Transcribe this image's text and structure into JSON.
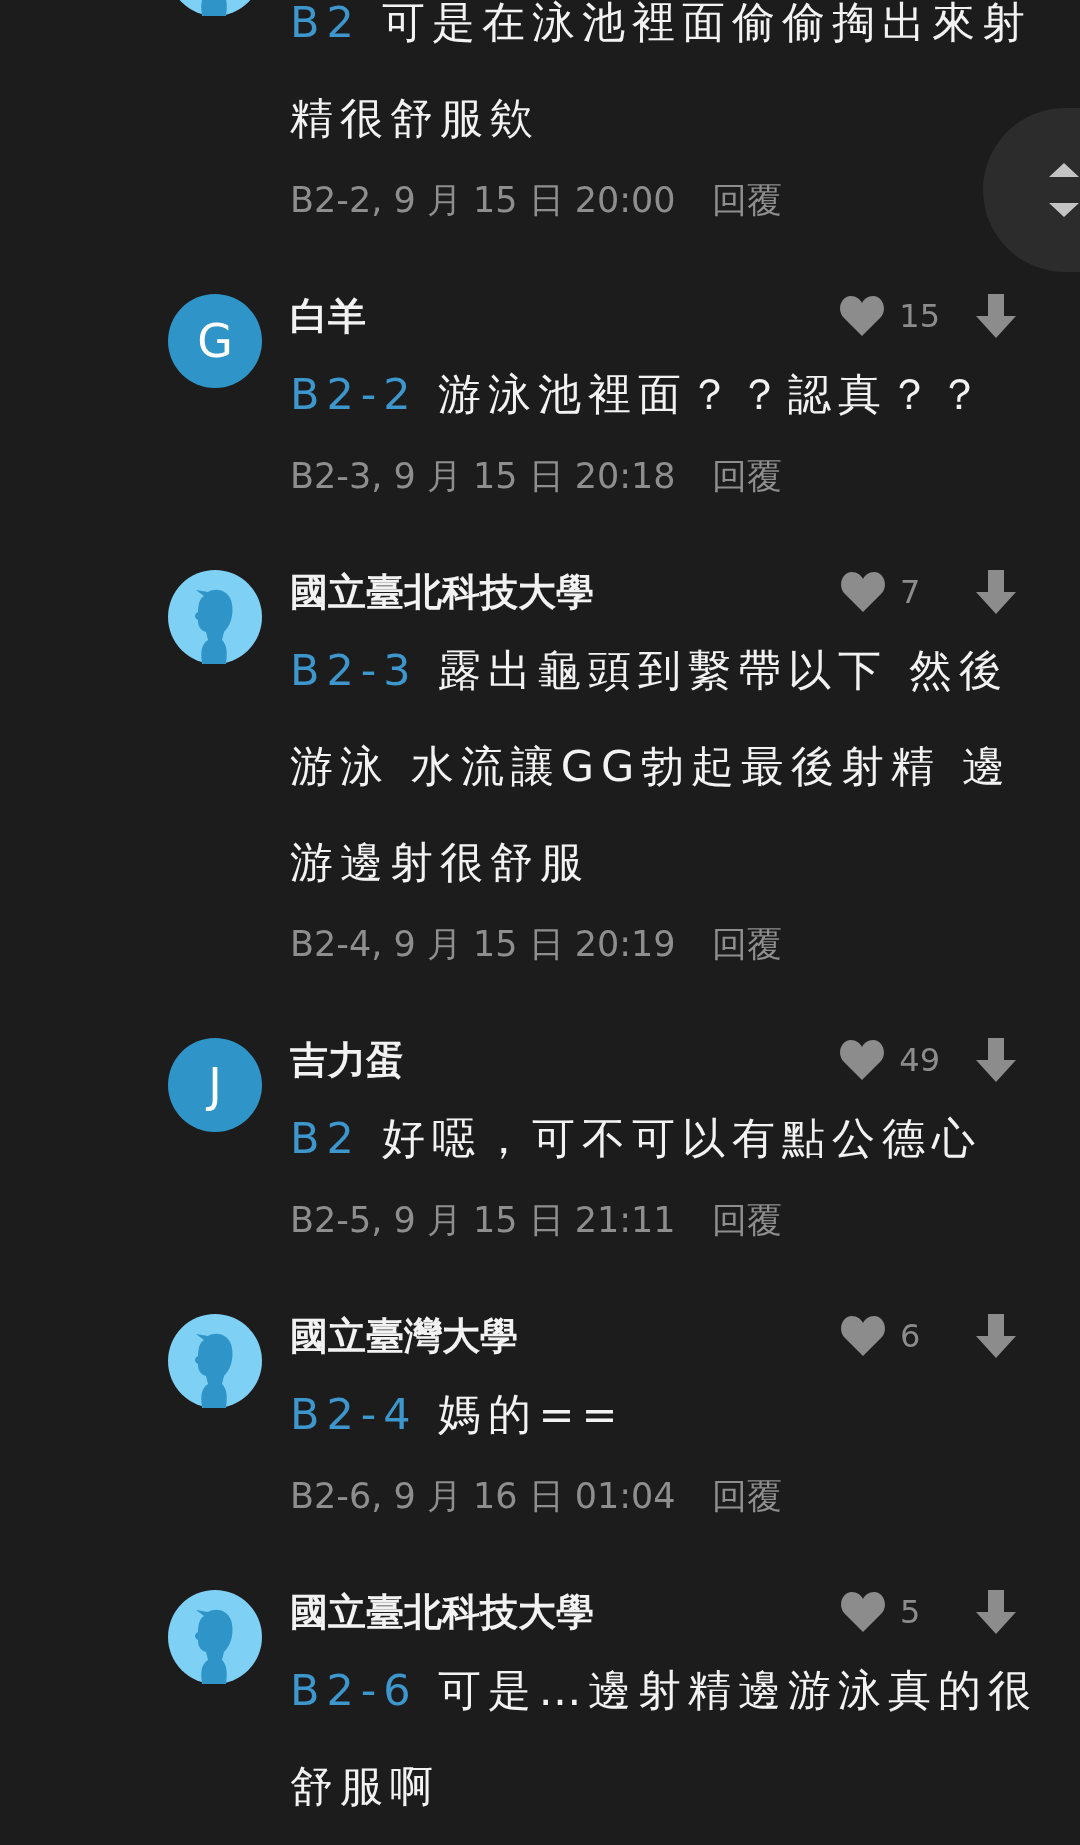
{
  "comments": [
    {
      "avatar": {
        "kind": "silhouette"
      },
      "reply_to": "B2",
      "text": "可是在泳池裡面偷偷掏出來射精很舒服欸",
      "floor": "B2-2, 9 月 15 日 20:00",
      "reply": "回覆"
    },
    {
      "avatar": {
        "kind": "letter",
        "letter": "G"
      },
      "author": "白羊",
      "likes": "15",
      "reply_to": "B2-2",
      "text": "游泳池裡面？？認真？？",
      "floor": "B2-3, 9 月 15 日 20:18",
      "reply": "回覆"
    },
    {
      "avatar": {
        "kind": "silhouette"
      },
      "author": "國立臺北科技大學",
      "likes": "7",
      "reply_to": "B2-3",
      "text": "露出龜頭到繫帶以下 然後游泳 水流讓GG勃起最後射精 邊游邊射很舒服",
      "floor": "B2-4, 9 月 15 日 20:19",
      "reply": "回覆"
    },
    {
      "avatar": {
        "kind": "letter",
        "letter": "J"
      },
      "author": "吉力蛋",
      "likes": "49",
      "reply_to": "B2",
      "text": "好噁，可不可以有點公德心",
      "floor": "B2-5, 9 月 15 日 21:11",
      "reply": "回覆"
    },
    {
      "avatar": {
        "kind": "silhouette"
      },
      "author": "國立臺灣大學",
      "likes": "6",
      "reply_to": "B2-4",
      "text": "媽的==",
      "floor": "B2-6, 9 月 16 日 01:04",
      "reply": "回覆"
    },
    {
      "avatar": {
        "kind": "silhouette"
      },
      "author": "國立臺北科技大學",
      "likes": "5",
      "reply_to": "B2-6",
      "text": "可是…邊射精邊游泳真的很舒服啊"
    }
  ]
}
